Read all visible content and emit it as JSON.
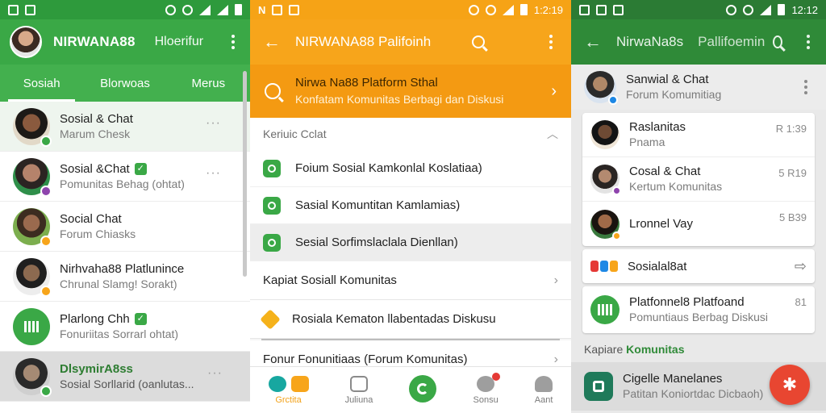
{
  "colors": {
    "green": "#3aa846",
    "green_dark": "#2e9a3c",
    "orange": "#f7a51b",
    "red": "#e84631"
  },
  "panel1": {
    "status": {
      "time": ""
    },
    "header": {
      "title": "NIRWANA88",
      "subtitle": "Hloerifur",
      "avatar_icon": "user-avatar-icon"
    },
    "tabs": [
      "Sosiah",
      "Blorwoas",
      "Merus"
    ],
    "chats": [
      {
        "name": "Sosial & Chat",
        "message": "Marum Chesk",
        "badge": "#3aa846",
        "verified": false
      },
      {
        "name": "Sosial &Chat",
        "message": "Pomunitas Behag (ohtat)",
        "badge": "#8e44ad",
        "verified": true
      },
      {
        "name": "Social Chat",
        "message": "Forum Chiasks",
        "badge": "#f7a51b",
        "verified": false
      },
      {
        "name": "Nirhvaha88 Platlunince",
        "message": "Chrunal Slamg! Sorakt)",
        "badge": "#f7a51b",
        "verified": false
      },
      {
        "name": "Plarlong Chh",
        "message": "Fonuriitas Sorrarl ohtat)",
        "badge": "#3aa846",
        "verified": true
      },
      {
        "name": "DlsymirA8ss",
        "message": "Sosial Sorllarid (oanlutas...",
        "badge": "#3aa846",
        "verified": false
      }
    ]
  },
  "panel2": {
    "status": {
      "time": "1:2:19"
    },
    "header": {
      "title": "NIRWANA88 Palifoinh"
    },
    "banner": {
      "title": "Nirwa Na88 Platform Sthal",
      "subtitle": "Konfatam Komunitas Berbagi dan Diskusi"
    },
    "section": "Keriuic Cclat",
    "items": [
      "Foium Sosial Kamkonlal Koslatiaa)",
      "Sasial Komuntitan Kamlamias)",
      "Sesial Sorfimslaclala Dienllan)"
    ],
    "links": [
      "Kapiat Sosiall Komunitas",
      "Rosiala Kematon llabentadas Diskusu",
      "Fonur Fonunitiaas (Forum Komunitas)"
    ],
    "nav": [
      {
        "label": "Grctita"
      },
      {
        "label": "Juliuna"
      },
      {
        "label": ""
      },
      {
        "label": "Sonsu"
      },
      {
        "label": "Aant"
      }
    ]
  },
  "panel3": {
    "status": {
      "time": "12:12"
    },
    "header": {
      "title": "NirwaNa8s",
      "subtitle": "Pallifoemin"
    },
    "head": {
      "name": "Sanwial & Chat",
      "message": "Forum Komumitiag"
    },
    "chats": [
      {
        "name": "Raslanitas",
        "message": "Pnama",
        "time": "R 1:39",
        "badge": ""
      },
      {
        "name": "Cosal & Chat",
        "message": "Kertum Komunitas",
        "time": "5 R19",
        "badge": "#8e44ad"
      },
      {
        "name": "Lronnel Vay",
        "message": "",
        "time": "5 B39",
        "badge": "#f7a51b"
      }
    ],
    "single": {
      "name": "Sosialal8at"
    },
    "platform": {
      "title": "Platfonnel8 Platfoand",
      "message": "Pomuntiaus Berbag Diskusi",
      "time": "81"
    },
    "section_prefix": "Kapiare",
    "section_highlight": "Komunitas",
    "last": {
      "name": "Cigelle Manelanes",
      "message": "Patitan Koniortdac Dicbaoh)"
    }
  }
}
